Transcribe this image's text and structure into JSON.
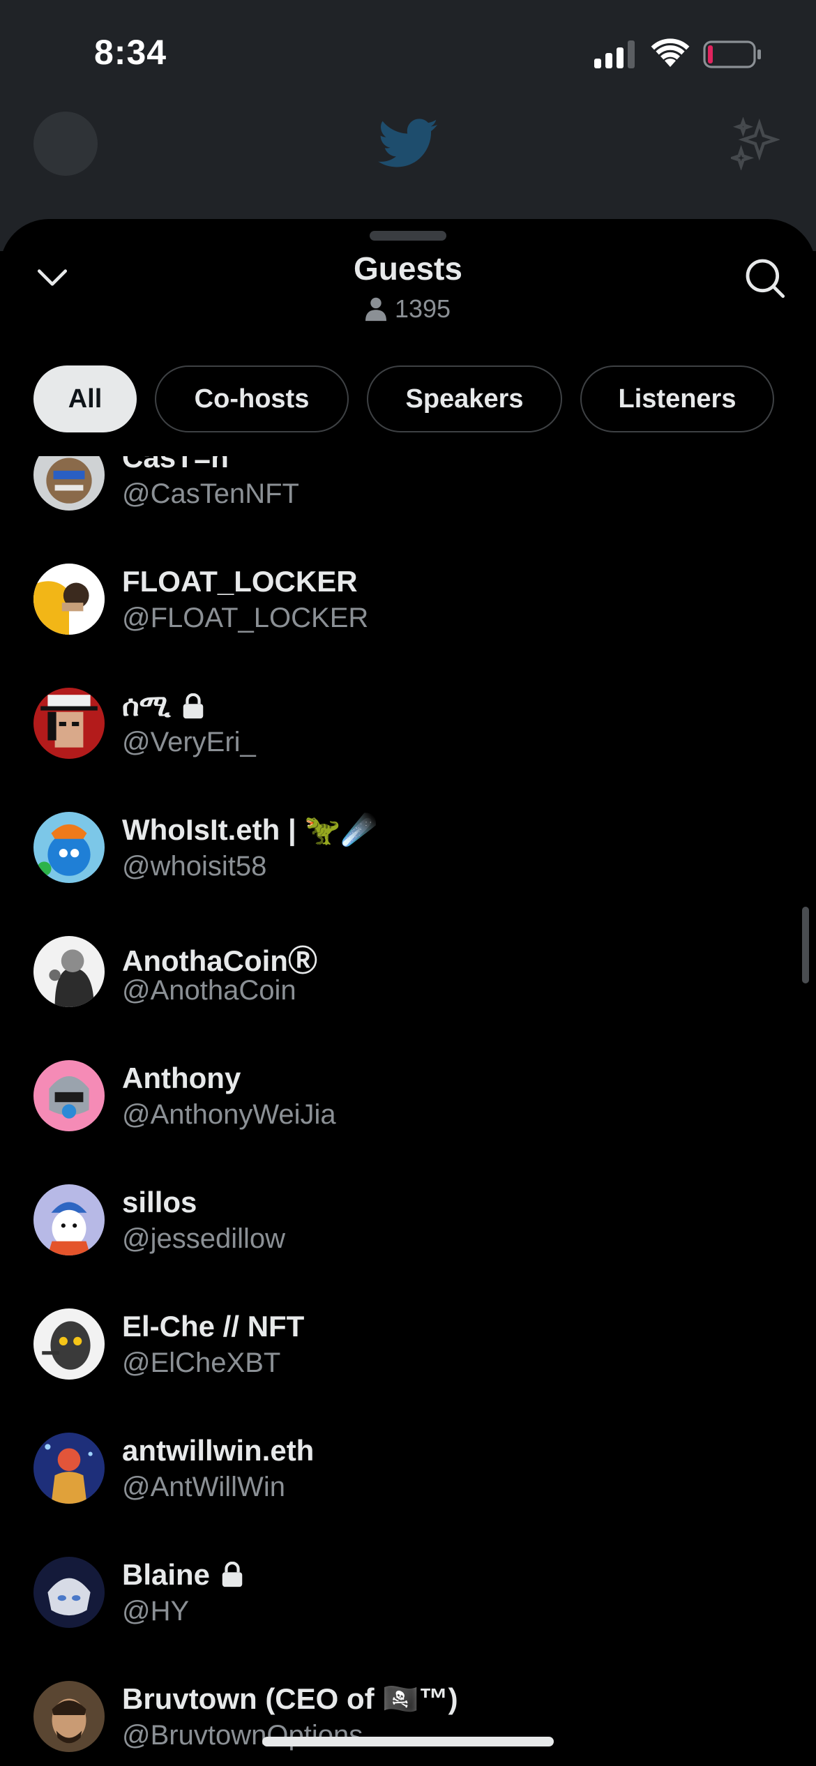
{
  "status_bar": {
    "time": "8:34"
  },
  "sheet": {
    "title": "Guests",
    "count": "1395",
    "tabs": [
      {
        "label": "All",
        "active": true
      },
      {
        "label": "Co-hosts",
        "active": false
      },
      {
        "label": "Speakers",
        "active": false
      },
      {
        "label": "Listeners",
        "active": false
      }
    ]
  },
  "guests": [
    {
      "name": "CasT=n",
      "handle": "@CasTenNFT"
    },
    {
      "name": "FLOAT_LOCKER",
      "handle": "@FLOAT_LOCKER"
    },
    {
      "name": "ሰሚ",
      "handle": "@VeryEri_",
      "locked": true
    },
    {
      "name": "WhoIsIt.eth | 🦖☄️",
      "handle": "@whoisit58"
    },
    {
      "name": "AnothaCoinⓇ",
      "handle": "@AnothaCoin"
    },
    {
      "name": "Anthony",
      "handle": "@AnthonyWeiJia"
    },
    {
      "name": "sillos",
      "handle": "@jessedillow"
    },
    {
      "name": "El-Che // NFT",
      "handle": "@ElCheXBT"
    },
    {
      "name": "antwillwin.eth",
      "handle": "@AntWillWin"
    },
    {
      "name": "Blaine",
      "handle": "@HY",
      "locked": true
    },
    {
      "name": "Bruvtown (CEO of 🏴‍☠️™)",
      "handle": "@BruvtownOptions"
    }
  ],
  "colors": {
    "accent": "#e7e9ea",
    "secondary_text": "#8b9095",
    "battery_low": "#e0245e"
  },
  "icons": [
    "chevron-down-icon",
    "search-icon",
    "person-icon",
    "lock-icon",
    "twitter-bird-icon",
    "sparkle-icon"
  ]
}
